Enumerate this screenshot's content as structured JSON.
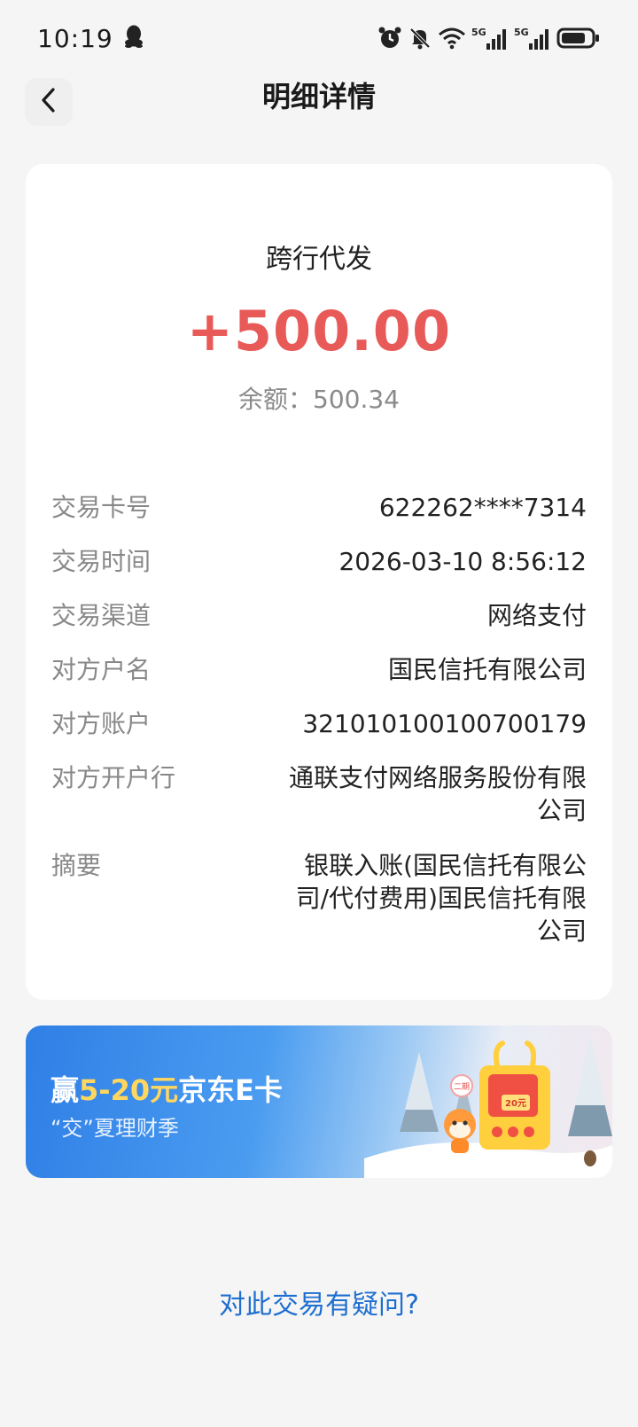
{
  "status_bar": {
    "time": "10:19",
    "icons": [
      "qq-icon",
      "alarm-icon",
      "mute-icon",
      "wifi-icon",
      "signal-5g-icon",
      "signal-5g-icon",
      "battery-icon"
    ],
    "network_labels": [
      "5G",
      "5G"
    ]
  },
  "nav": {
    "title": "明细详情",
    "back_icon": "chevron-left-icon"
  },
  "transaction": {
    "type": "跨行代发",
    "amount": "+500.00",
    "amount_color": "#e85a58",
    "balance": "余额：500.34"
  },
  "details": [
    {
      "label": "交易卡号",
      "value": "622262****7314"
    },
    {
      "label": "交易时间",
      "value": "2026-03-10 8:56:12"
    },
    {
      "label": "交易渠道",
      "value": "网络支付"
    },
    {
      "label": "对方户名",
      "value": "国民信托有限公司"
    },
    {
      "label": "对方账户",
      "value": "321010100100700179"
    },
    {
      "label": "对方开户行",
      "value": "通联支付网络服务股份有限公司"
    },
    {
      "label": "摘要",
      "value": "银联入账(国民信托有限公司/代付费用)国民信托有限公司"
    }
  ],
  "promo": {
    "title_prefix": "赢",
    "title_highlight": "5-20元",
    "title_suffix": "京东E卡",
    "subtitle": "“交”夏理财季",
    "badge_top": "二期",
    "badge_value": "20元"
  },
  "footer": {
    "question_link": "对此交易有疑问?",
    "link_color": "#1e6fd0"
  }
}
